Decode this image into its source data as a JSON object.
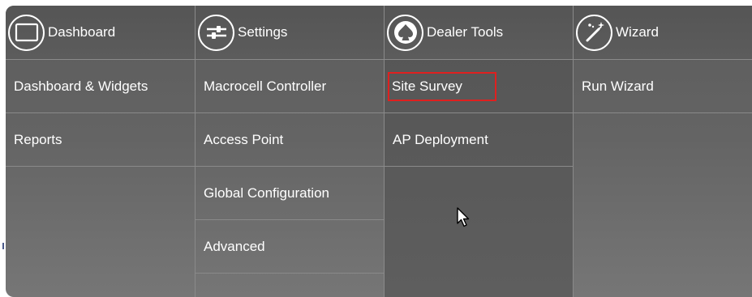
{
  "columns": [
    {
      "title": "Dashboard",
      "icon": "monitor-icon",
      "items": [
        "Dashboard & Widgets",
        "Reports"
      ]
    },
    {
      "title": "Settings",
      "icon": "sliders-icon",
      "items": [
        "Macrocell Controller",
        "Access Point",
        "Global Configuration",
        "Advanced"
      ]
    },
    {
      "title": "Dealer Tools",
      "icon": "spade-icon",
      "items": [
        "Site Survey",
        "AP Deployment"
      ],
      "highlighted_item": "Site Survey"
    },
    {
      "title": "Wizard",
      "icon": "magic-wand-icon",
      "items": [
        "Run Wizard"
      ]
    }
  ],
  "colors": {
    "highlight_border": "#e0201f",
    "menu_background": "#646464",
    "text": "#ffffff"
  }
}
